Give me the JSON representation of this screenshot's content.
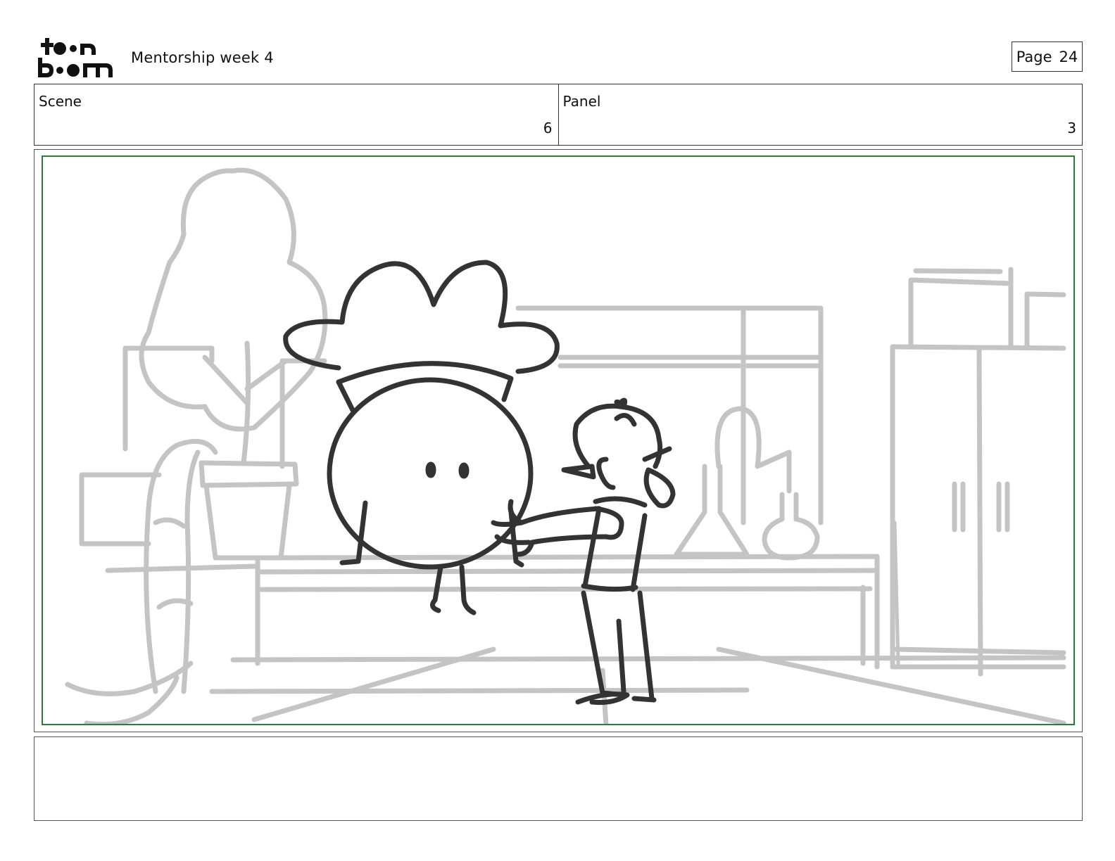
{
  "header": {
    "brand_logo": "toon boom",
    "title": "Mentorship week 4",
    "page_label": "Page",
    "page_number": "24"
  },
  "info": {
    "scene_label": "Scene",
    "scene_value": "6",
    "panel_label": "Panel",
    "panel_value": "3"
  },
  "notes": {
    "text": ""
  },
  "colors": {
    "safe_frame": "#2e7d32",
    "sketch_dark": "#333333",
    "sketch_light": "#c4c4c4"
  }
}
